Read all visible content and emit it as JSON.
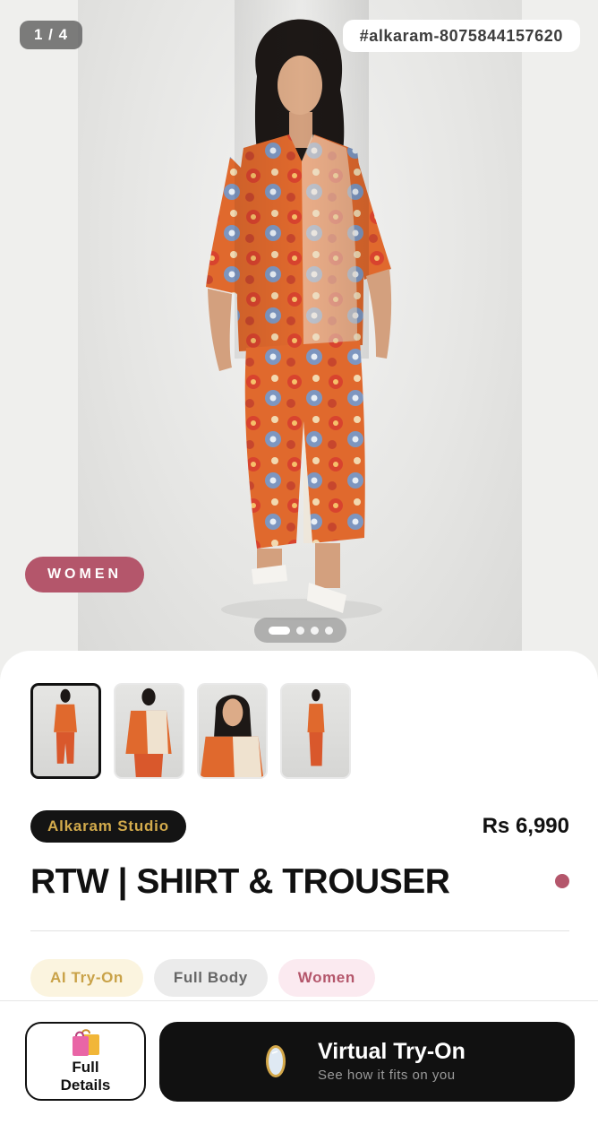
{
  "gallery": {
    "counter": "1 / 4",
    "sku": "#alkaram-8075844157620",
    "category_badge": "WOMEN",
    "dots_total": 4,
    "dots_active_index": 0
  },
  "thumbnails": [
    {
      "label": "thumbnail-1",
      "selected": true
    },
    {
      "label": "thumbnail-2",
      "selected": false
    },
    {
      "label": "thumbnail-3",
      "selected": false
    },
    {
      "label": "thumbnail-4",
      "selected": false
    }
  ],
  "product": {
    "brand": "Alkaram Studio",
    "price": "Rs 6,990",
    "title": "RTW | SHIRT & TROUSER"
  },
  "tags": [
    "AI Try-On",
    "Full Body",
    "Women"
  ],
  "actions": {
    "details_label_line1": "Full",
    "details_label_line2": "Details",
    "details_icon": "shopping-bags-icon",
    "tryon_title": "Virtual Try-On",
    "tryon_subtitle": "See how it fits on you",
    "tryon_icon": "mirror-icon"
  },
  "colors": {
    "accent": "#b4566b",
    "brand_text": "#d3ab4c",
    "dark": "#111111"
  }
}
